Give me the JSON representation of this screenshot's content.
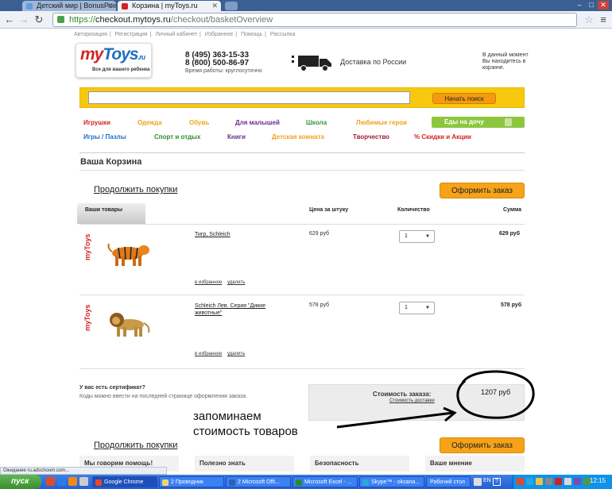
{
  "browser": {
    "tabs": [
      {
        "label": "Детский мир | BonusPoint",
        "active": false
      },
      {
        "label": "Корзина | myToys.ru",
        "active": true
      }
    ],
    "url_scheme": "https://",
    "url_host": "checkout.mytoys.ru",
    "url_path": "/checkout/basketOverview",
    "status_text": "Ожидание ru.adschoom.com..."
  },
  "topnav": [
    "Авторизация",
    "Регистрация",
    "Личный кабинет",
    "Избранное",
    "Помощь",
    "Рассылка"
  ],
  "logo": {
    "my": "my",
    "toys": "Toys",
    "ru": ".ru",
    "tagline": "Все для вашего ребенка"
  },
  "contacts": {
    "phone1": "8 (495) 363-15-33",
    "phone2": "8 (800) 500-86-97",
    "hours": "Время работы: круглосуточно"
  },
  "delivery": "Доставка по России",
  "basket_info": "В данный момент Вы находитесь в корзине.",
  "search": {
    "button": "Начать поиск",
    "value": ""
  },
  "categories_row1": [
    {
      "label": "Игрушки",
      "color": "#d42222"
    },
    {
      "label": "Одежда",
      "color": "#f0a21a"
    },
    {
      "label": "Обувь",
      "color": "#e8a81d"
    },
    {
      "label": "Для малышей",
      "color": "#6a2c91"
    },
    {
      "label": "Школа",
      "color": "#2f9a3b"
    },
    {
      "label": "Любимые герои",
      "color": "#f0a21a"
    }
  ],
  "categories_row2": [
    {
      "label": "Игры / Пазлы",
      "color": "#1d6fc4"
    },
    {
      "label": "Спорт и отдых",
      "color": "#2f8a2f"
    },
    {
      "label": "Книги",
      "color": "#6a2c91"
    },
    {
      "label": "Детская комната",
      "color": "#f0a21a"
    },
    {
      "label": "Творчество",
      "color": "#a01f3a"
    },
    {
      "label": "% Скидки и Акции",
      "color": "#d42222"
    }
  ],
  "food_button": "Еды на дочу",
  "basket_title": "Ваша Корзина",
  "continue_label": "Продолжить покупки",
  "order_label": "Оформить заказ",
  "columns": {
    "items": "Ваши товары",
    "price": "Цена за штуку",
    "qty": "Количество",
    "sum": "Сумма"
  },
  "items": [
    {
      "name": "Тигр, Schleich",
      "price": "629 руб",
      "qty": "1",
      "sum": "629 руб",
      "fav": "в избранное",
      "del": "удалить"
    },
    {
      "name": "Schleich Лев. Серия \"Дикие животные\"",
      "price": "578 руб",
      "qty": "1",
      "sum": "578 руб",
      "fav": "в избранное",
      "del": "удалить"
    }
  ],
  "row_logo": "myToys",
  "certificate": {
    "question": "У вас есть сертификат?",
    "note": "Коды можно ввести на последней странице оформления заказа."
  },
  "total": {
    "label": "Стоимость заказа:",
    "link": "Стоимость доставки",
    "value": "1207 руб"
  },
  "annotation": [
    "запоминаем",
    "стоимость товаров"
  ],
  "footer_cols": [
    "Мы говорим помощь!",
    "Полезно знать",
    "Безопасность",
    "Ваше мнение"
  ],
  "taskbar": {
    "start": "пуск",
    "tasks": [
      "Google Chrome",
      "2 Проводник",
      "2 Microsoft Offi...",
      "Microsoft Excel - ...",
      "Skype™ - oksana...",
      "Рабочий стол"
    ],
    "active_task": "Google Chrome",
    "clock": "12:15",
    "lang": "EN"
  }
}
